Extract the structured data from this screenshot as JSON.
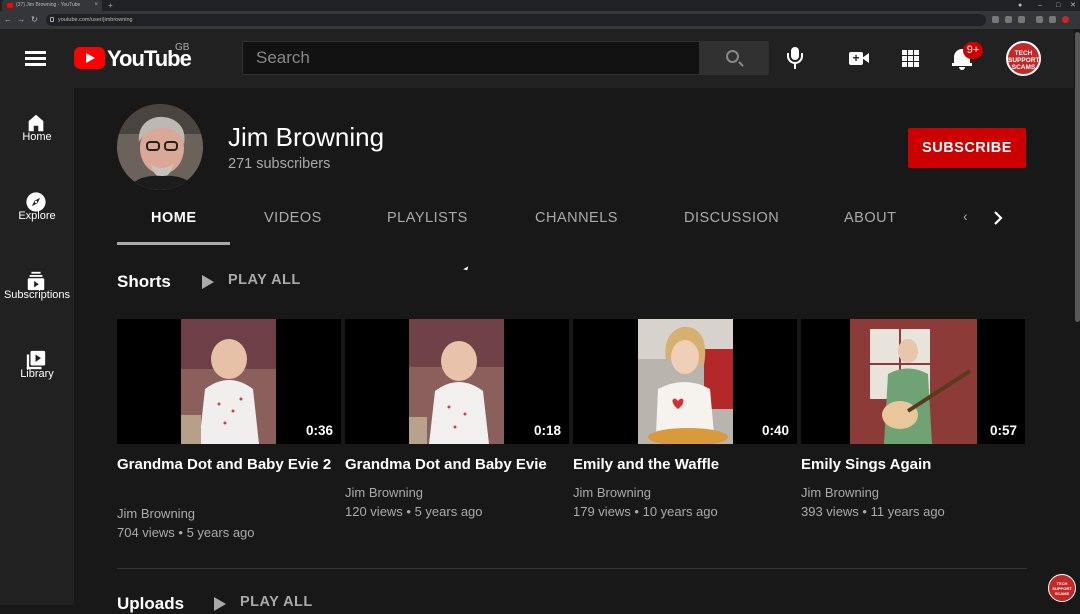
{
  "browser": {
    "tab_title": "(37) Jim Browning - YouTube",
    "tab_close": "×",
    "new_tab": "+",
    "url": "youtube.com/user/jimbrowning",
    "back": "←",
    "forward": "→",
    "reload": "↻",
    "minimize": "–",
    "maximize": "□",
    "close": "✕"
  },
  "header": {
    "logo_text": "YouTube",
    "region": "GB",
    "search_placeholder": "Search",
    "notifications_badge": "9+",
    "avatar_text": "TECH SUPPORT SCAMS"
  },
  "sidebar": {
    "items": [
      {
        "label": "Home",
        "icon": "home-icon"
      },
      {
        "label": "Explore",
        "icon": "compass-icon"
      },
      {
        "label": "Subscriptions",
        "icon": "subscriptions-icon"
      },
      {
        "label": "Library",
        "icon": "library-icon"
      }
    ]
  },
  "channel": {
    "name": "Jim Browning",
    "subscribers": "271 subscribers",
    "subscribe_label": "SUBSCRIBE",
    "tabs": [
      "HOME",
      "VIDEOS",
      "PLAYLISTS",
      "CHANNELS",
      "DISCUSSION",
      "ABOUT"
    ],
    "active_tab": "HOME",
    "tab_prev": "‹"
  },
  "shorts": {
    "title": "Shorts",
    "play_all": "PLAY ALL",
    "videos": [
      {
        "title": "Grandma Dot and Baby Evie 2",
        "author": "Jim Browning",
        "stats": "704 views • 5 years ago",
        "duration": "0:36"
      },
      {
        "title": "Grandma Dot and Baby Evie",
        "author": "Jim Browning",
        "stats": "120 views • 5 years ago",
        "duration": "0:18"
      },
      {
        "title": "Emily and the Waffle",
        "author": "Jim Browning",
        "stats": "179 views • 10 years ago",
        "duration": "0:40"
      },
      {
        "title": "Emily Sings Again",
        "author": "Jim Browning",
        "stats": "393 views • 11 years ago",
        "duration": "0:57"
      }
    ]
  },
  "uploads": {
    "title": "Uploads",
    "play_all": "PLAY ALL"
  },
  "watermark_text": "TECH SUPPORT SCAMS",
  "colors": {
    "brand_red": "#ff0000",
    "subscribe_red": "#cc0000",
    "background": "#181818",
    "header_bg": "#212121"
  }
}
